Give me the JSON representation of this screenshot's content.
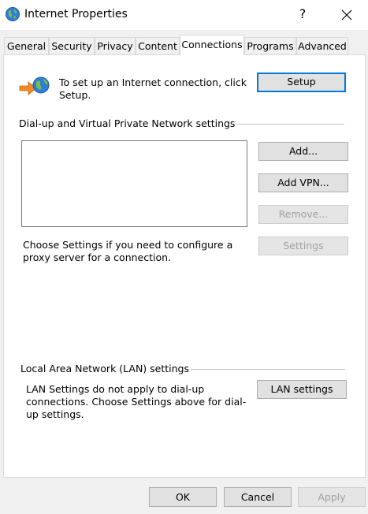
{
  "window": {
    "title": "Internet Properties",
    "help_glyph": "?"
  },
  "tabs": [
    {
      "label": "General",
      "active": false
    },
    {
      "label": "Security",
      "active": false
    },
    {
      "label": "Privacy",
      "active": false
    },
    {
      "label": "Content",
      "active": false
    },
    {
      "label": "Connections",
      "active": true
    },
    {
      "label": "Programs",
      "active": false
    },
    {
      "label": "Advanced",
      "active": false
    }
  ],
  "setup": {
    "text": "To set up an Internet connection, click Setup.",
    "button": "Setup"
  },
  "vpn_group": {
    "label": "Dial-up and Virtual Private Network settings",
    "add": "Add...",
    "add_vpn": "Add VPN...",
    "remove": "Remove...",
    "settings": "Settings",
    "proxy_text": "Choose Settings if you need to configure a proxy server for a connection."
  },
  "lan_group": {
    "label": "Local Area Network (LAN) settings",
    "text": "LAN Settings do not apply to dial-up connections. Choose Settings above for dial-up settings.",
    "button": "LAN settings"
  },
  "footer": {
    "ok": "OK",
    "cancel": "Cancel",
    "apply": "Apply"
  },
  "colors": {
    "accent": "#0078d7",
    "disabled_text": "#a0a0a0"
  },
  "icons": {
    "title": "globe-icon",
    "setup": "network-wizard-icon",
    "close": "close-icon"
  }
}
